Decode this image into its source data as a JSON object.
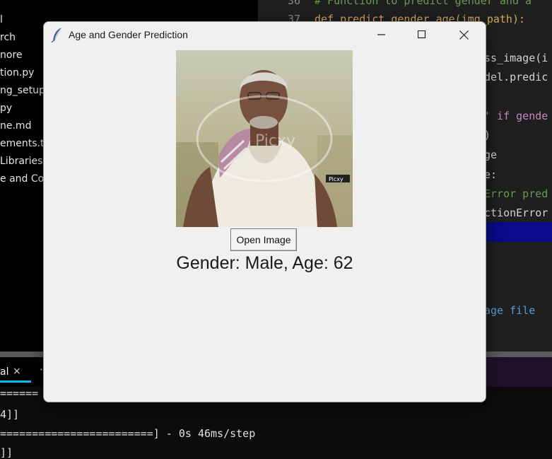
{
  "explorer": {
    "items": [
      "l",
      "rch",
      "nore",
      "tion.py",
      "ng_setup.p",
      "py",
      "ne.md",
      "ements.tx",
      "Libraries",
      "e and Con"
    ]
  },
  "editor": {
    "line_numbers": [
      "36",
      "37"
    ],
    "lines": [
      {
        "text": "# Function to predict gender and a",
        "color": "#6a9955"
      },
      {
        "text": "def predict_gender_age(img_path):",
        "color": "#d4a65a"
      },
      {
        "text": "ss_image(i",
        "color": "#d4d4d4"
      },
      {
        "text": "del.predic",
        "color": "#d4d4d4"
      },
      {
        "text": "' if gende",
        "color": "#d4d4d4"
      },
      {
        "text": ")",
        "color": "#d4d4d4"
      },
      {
        "text": "ge",
        "color": "#d4d4d4"
      },
      {
        "text": "e:",
        "color": "#d4d4d4"
      },
      {
        "text": "Error pred",
        "color": "#6a9955"
      },
      {
        "text": "ctionError",
        "color": "#d4d4d4"
      },
      {
        "text": "age file",
        "color": "#569cd6"
      }
    ]
  },
  "terminal_tab": {
    "label": "al",
    "close": "×"
  },
  "terminal": {
    "lines": [
      "======",
      "4]]",
      "========================] - 0s 46ms/step",
      "]]"
    ]
  },
  "dialog": {
    "title": "Age and Gender Prediction",
    "open_button": "Open Image",
    "result": "Gender: Male, Age: 62",
    "photo_watermark": "Picxy"
  },
  "colors": {
    "accent_tab": "#00c4e8",
    "editor_highlight": "#0a0a8a"
  }
}
